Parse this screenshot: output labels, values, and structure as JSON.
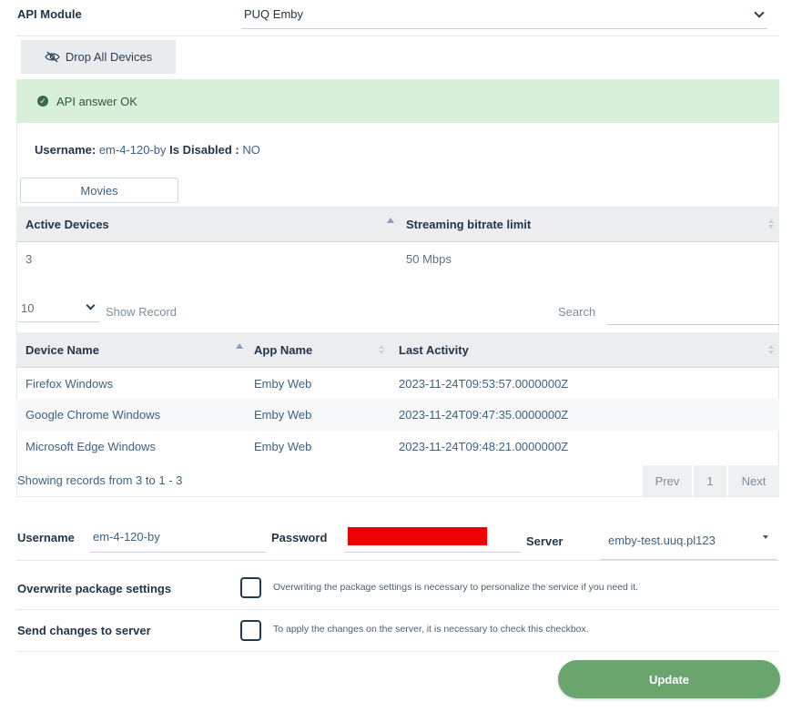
{
  "api_module": {
    "label": "API Module",
    "value": "PUQ Emby"
  },
  "drop_button": {
    "label": "Drop All Devices"
  },
  "alert": {
    "message": "API answer OK"
  },
  "user_info": {
    "username_label": "Username:",
    "username_value": "em-4-120-by",
    "disabled_label": "Is Disabled :",
    "disabled_value": "NO"
  },
  "tabs": [
    {
      "label": "Movies"
    }
  ],
  "limits_table": {
    "headers": [
      "Active Devices",
      "Streaming bitrate limit"
    ],
    "row": [
      "3",
      "50 Mbps"
    ]
  },
  "table_controls": {
    "page_size": "10",
    "show_record": "Show Record",
    "search_label": "Search",
    "search_value": ""
  },
  "devices_table": {
    "headers": [
      "Device Name",
      "App Name",
      "Last Activity"
    ],
    "rows": [
      [
        "Firefox Windows",
        "Emby Web",
        "2023-11-24T09:53:57.0000000Z"
      ],
      [
        "Google Chrome Windows",
        "Emby Web",
        "2023-11-24T09:47:35.0000000Z"
      ],
      [
        "Microsoft Edge Windows",
        "Emby Web",
        "2023-11-24T09:48:21.0000000Z"
      ]
    ],
    "summary": "Showing records from 3 to 1 - 3",
    "pager": {
      "prev": "Prev",
      "page": "1",
      "next": "Next"
    }
  },
  "form": {
    "username_label": "Username",
    "username_value": "em-4-120-by",
    "password_label": "Password",
    "server_label": "Server",
    "server_value": "emby-test.uuq.pl123",
    "overwrite_label": "Overwrite package settings",
    "overwrite_note": "Overwriting the package settings is necessary to personalize the service if you need it.",
    "send_label": "Send changes to server",
    "send_note": "To apply the changes on the server, it is necessary to check this checkbox.",
    "update_label": "Update"
  },
  "colors": {
    "success_bg": "#d8f0d9",
    "update_btn": "#6aa56e",
    "redaction": "#ee0000"
  }
}
